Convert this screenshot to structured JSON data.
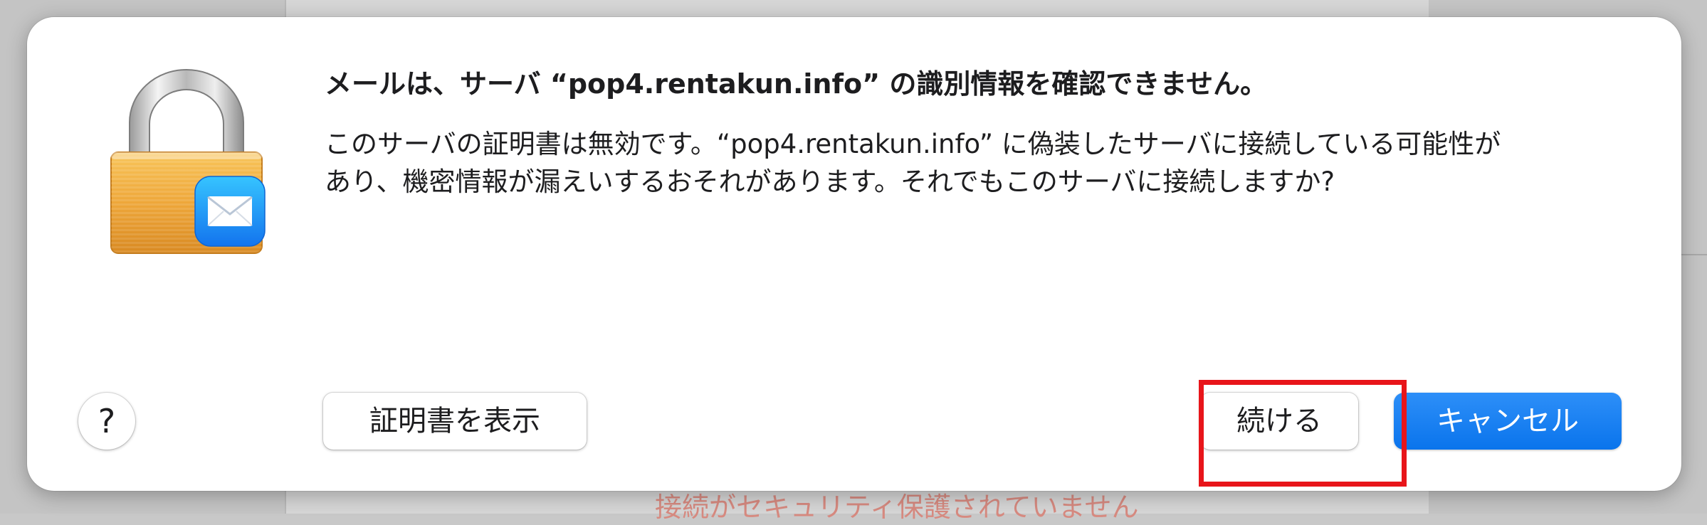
{
  "background": {
    "status_text": "接続がセキュリティ保護されていません",
    "status_color": "#d78a80"
  },
  "dialog": {
    "icon": "lock-mail-icon",
    "title": "メールは、サーバ “pop4.rentakun.info” の識別情報を確認できません。",
    "message_line1": "このサーバの証明書は無効です。“pop4.rentakun.info” に偽装したサーバに接続している可能性が",
    "message_line2": "あり、機密情報が漏えいするおそれがあります。それでもこのサーバに接続しますか?",
    "help_label": "?",
    "show_cert_label": "証明書を表示",
    "continue_label": "続ける",
    "cancel_label": "キャンセル",
    "accent_color": "#0a74ec",
    "highlight_color": "#e8151a"
  }
}
